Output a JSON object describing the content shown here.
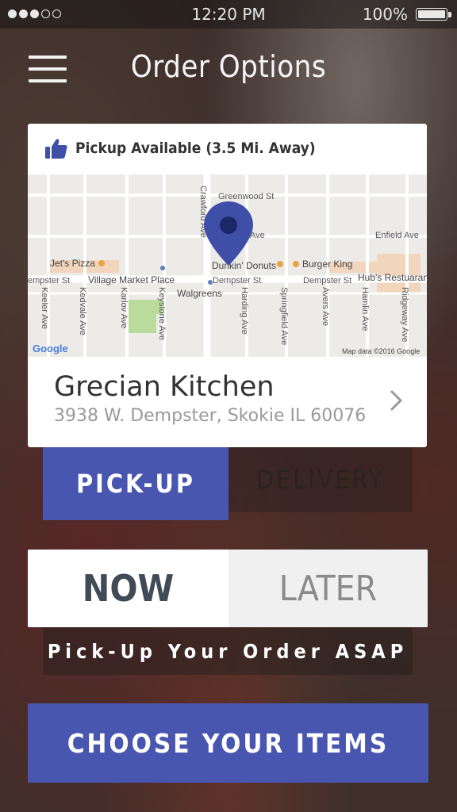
{
  "status_bar": {
    "time": "12:20 PM",
    "battery_percent": "100%",
    "signal_bars_filled": 3,
    "signal_bars_total": 5
  },
  "header": {
    "title": "Order Options",
    "menu_icon": "hamburger-menu-icon"
  },
  "restaurant_card": {
    "pickup_icon": "thumbs-up-icon",
    "pickup_text": "Pickup Available (3.5 Mi. Away)",
    "name": "Grecian Kitchen",
    "address": "3938 W. Dempster, Skokie IL 60076",
    "chevron_icon": "chevron-right-icon",
    "map": {
      "streets": [
        "Greenwood St",
        "Enfield Ave",
        "Dempster St",
        "Dempster St",
        "empster St",
        "Crawford Ave",
        "Keeler Ave",
        "Kedvale Ave",
        "Karlov Ave",
        "Keystone Ave",
        "Harding Ave",
        "Springfield Ave",
        "Avers Ave",
        "Hamlin Ave",
        "Ridgeway Ave",
        "Ave"
      ],
      "places": [
        "Jet's Pizza",
        "Village Market Place",
        "Walgreens",
        "Dunkin' Donuts",
        "Burger King",
        "Hub's Restuaran"
      ],
      "logo": "Google",
      "attribution": "Map data ©2016 Google",
      "marker_icon": "map-pin-icon"
    }
  },
  "order_type": {
    "pickup_label": "PICK-UP",
    "delivery_label": "DELIVERY",
    "selected": "PICK-UP"
  },
  "timing": {
    "now_label": "NOW",
    "later_label": "LATER",
    "selected": "NOW",
    "message": "Pick-Up Your Order ASAP"
  },
  "cta": {
    "label": "CHOOSE YOUR ITEMS"
  },
  "colors": {
    "accent": "#4856b0",
    "pin": "#3f4fa8"
  }
}
